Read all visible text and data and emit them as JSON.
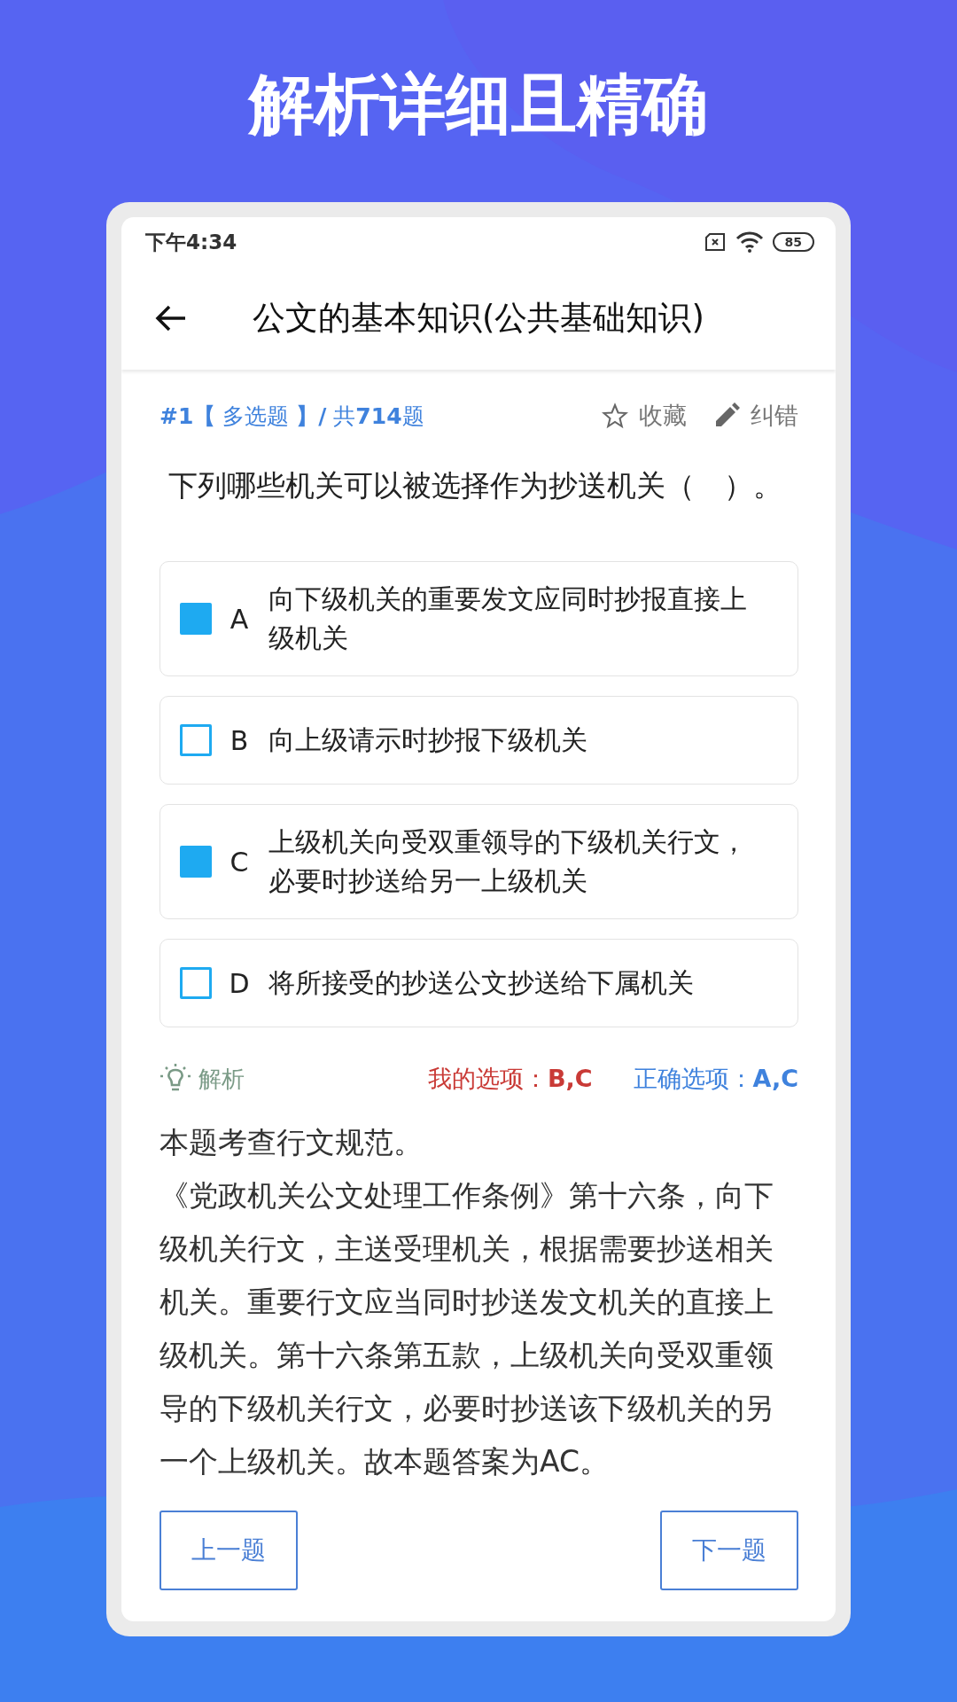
{
  "headline": "解析详细且精确",
  "status_bar": {
    "time": "下午4:34",
    "battery": "85"
  },
  "app_bar": {
    "title": "公文的基本知识(公共基础知识)"
  },
  "question": {
    "meta": "**#1【** 多选题 **】/** 共**714**题",
    "actions": [
      {
        "kind": "star",
        "label": "收藏"
      },
      {
        "kind": "pencil",
        "label": "纠错"
      }
    ],
    "text": "下列哪些机关可以被选择作为抄送机关（　）。"
  },
  "options": [
    {
      "letter": "A",
      "text": "向下级机关的重要发文应同时抄报直接上级机关",
      "selected": true
    },
    {
      "letter": "B",
      "text": "向上级请示时抄报下级机关",
      "selected": false
    },
    {
      "letter": "C",
      "text": "上级机关向受双重领导的下级机关行文，必要时抄送给另一上级机关",
      "selected": true
    },
    {
      "letter": "D",
      "text": "将所接受的抄送公文抄送给下属机关",
      "selected": false
    }
  ],
  "analysis": {
    "label": "解析",
    "my_answer": "我的选项：**B,C**",
    "correct_answer": "正确选项：**A,C**",
    "paragraphs": [
      "本题考查行文规范。",
      "《党政机关公文处理工作条例》第十六条，向下级机关行文，主送受理机关，根据需要抄送相关机关。重要行文应当同时抄送发文机关的直接上级机关。第十六条第五款，上级机关向受双重领导的下级机关行文，必要时抄送该下级机关的另一个上级机关。故本题答案为AC。"
    ]
  },
  "buttons": [
    "上一题",
    "下一题"
  ]
}
